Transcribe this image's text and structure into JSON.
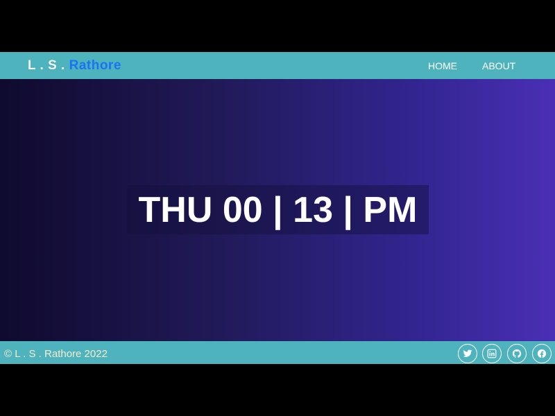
{
  "navbar": {
    "brand_initials": "L . S . ",
    "brand_surname": "Rathore",
    "links": [
      {
        "label": "HOME"
      },
      {
        "label": "ABOUT"
      }
    ]
  },
  "clock": {
    "display": "THU 00 | 13 | PM"
  },
  "footer": {
    "copyright": "© L . S . Rathore 2022",
    "social_icons": [
      "twitter-icon",
      "linkedin-icon",
      "github-icon",
      "facebook-icon"
    ]
  },
  "colors": {
    "bar_teal": "#4fb3bd",
    "brand_blue": "#1a73f5",
    "gradient_start": "#0f0a2e",
    "gradient_end": "#4a2fb5"
  }
}
